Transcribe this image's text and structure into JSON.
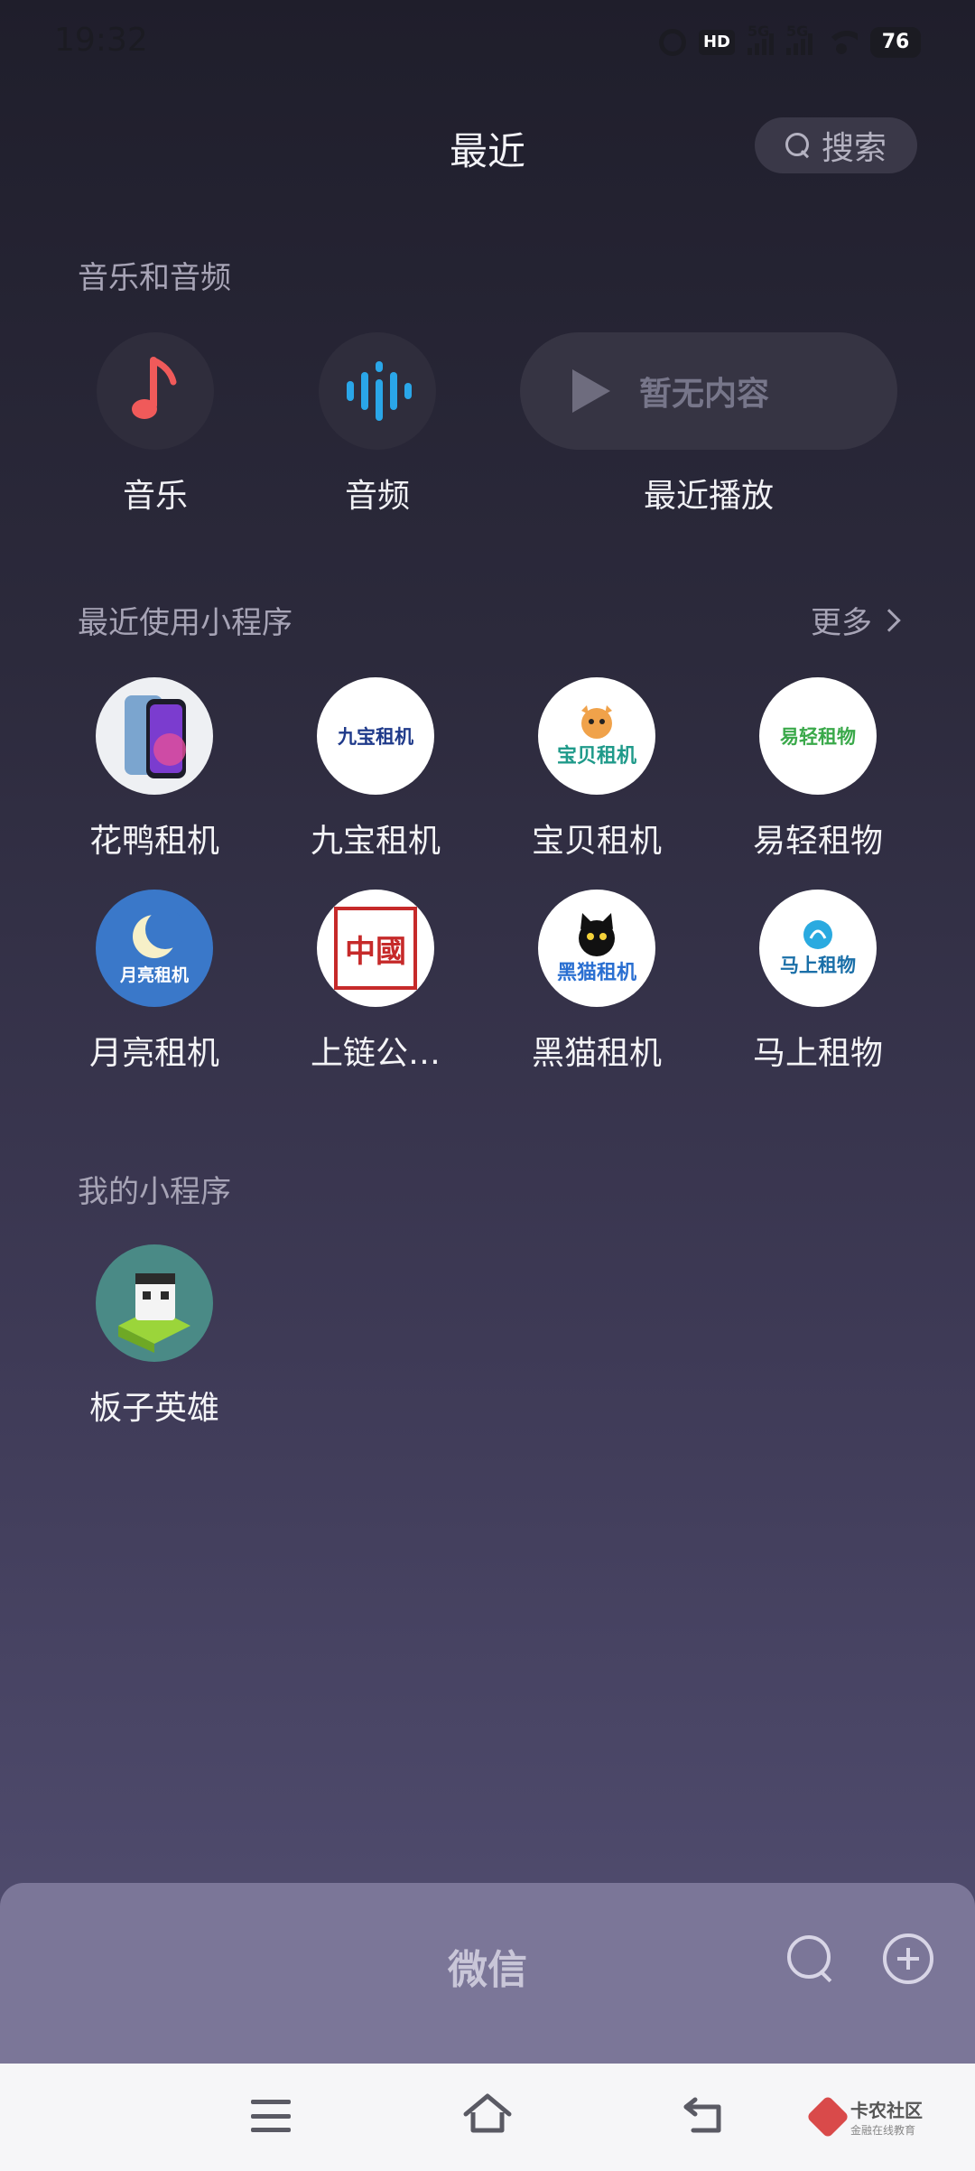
{
  "status_bar": {
    "time": "19:32",
    "hd_label": "HD",
    "sim1_label": "5G",
    "sim2_label": "5G",
    "battery": "76",
    "icons": [
      "alarm-icon",
      "hd-icon",
      "signal-icon",
      "signal-icon",
      "wifi-icon",
      "battery-icon"
    ]
  },
  "header": {
    "title": "最近",
    "search_label": "搜索"
  },
  "media_section": {
    "title": "音乐和音频",
    "items": [
      {
        "label": "音乐",
        "icon": "music-note-icon",
        "color": "#f05a5a"
      },
      {
        "label": "音频",
        "icon": "audio-wave-icon",
        "color": "#2aa6e8"
      }
    ],
    "recent_play": {
      "placeholder": "暂无内容",
      "label": "最近播放",
      "icon": "play-icon"
    }
  },
  "recent_apps": {
    "title": "最近使用小程序",
    "more_label": "更多",
    "items": [
      {
        "label": "花鸭租机"
      },
      {
        "label": "九宝租机",
        "logo_text": "九宝租机"
      },
      {
        "label": "宝贝租机",
        "logo_text": "宝贝租机"
      },
      {
        "label": "易轻租物",
        "logo_text": "易轻租物"
      },
      {
        "label": "月亮租机",
        "logo_text": "月亮租机"
      },
      {
        "label": "上链公…",
        "logo_text": "中國"
      },
      {
        "label": "黑猫租机",
        "logo_text": "黑猫租机"
      },
      {
        "label": "马上租物",
        "logo_text": "马上租物"
      }
    ]
  },
  "my_apps": {
    "title": "我的小程序",
    "items": [
      {
        "label": "板子英雄"
      }
    ]
  },
  "bottom_panel": {
    "title": "微信",
    "icons": [
      "search-icon",
      "add-icon"
    ]
  },
  "watermark": {
    "name": "卡农社区",
    "tagline": "金融在线教育"
  },
  "colors": {
    "accent_red": "#f05a5a",
    "accent_blue": "#2aa6e8",
    "panel": "#7b7698"
  }
}
